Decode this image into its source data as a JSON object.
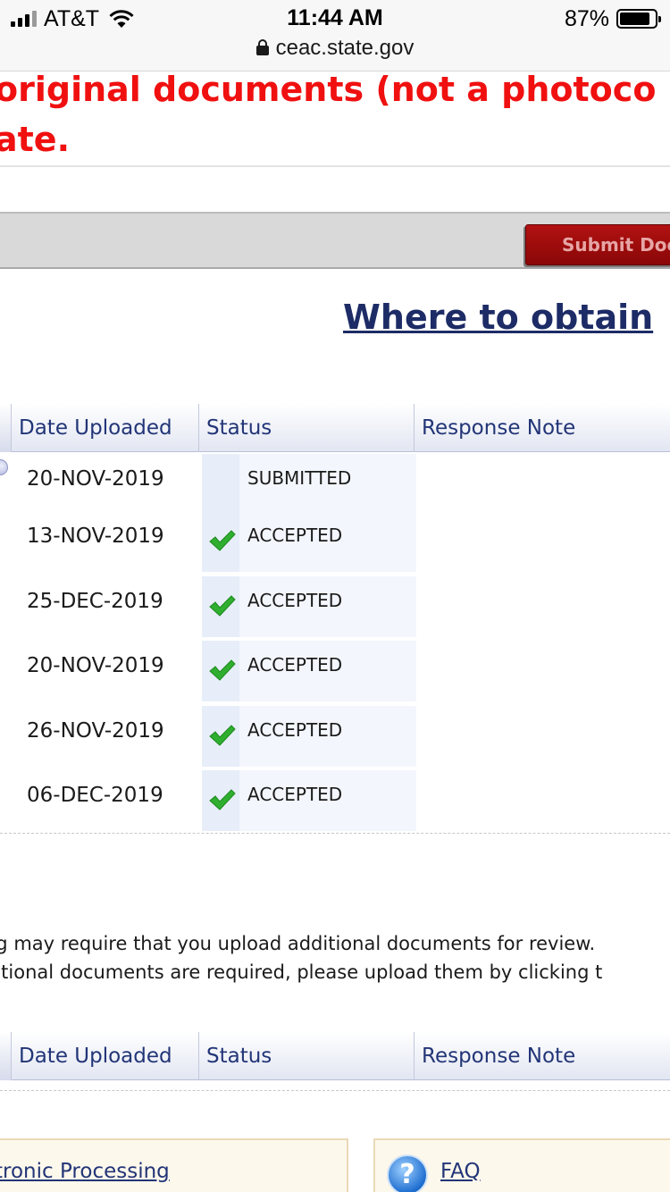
{
  "status_bar": {
    "carrier": "AT&T",
    "time": "11:44 AM",
    "battery_percent": "87%",
    "battery_level": 0.87,
    "url": "ceac.state.gov"
  },
  "warning": {
    "line1": "original documents (not a photoco",
    "line2": "ate."
  },
  "toolbar": {
    "submit_label": "Submit Doc"
  },
  "obtain_link": "Where to obtain",
  "table_headers": [
    "Date Uploaded",
    "Status",
    "Response Note"
  ],
  "documents": [
    {
      "date": "20-NOV-2019",
      "status": "SUBMITTED",
      "icon": "none"
    },
    {
      "date": "13-NOV-2019",
      "status": "ACCEPTED",
      "icon": "check-icon"
    },
    {
      "date": "25-DEC-2019",
      "status": "ACCEPTED",
      "icon": "check-icon"
    },
    {
      "date": "20-NOV-2019",
      "status": "ACCEPTED",
      "icon": "check-icon"
    },
    {
      "date": "26-NOV-2019",
      "status": "ACCEPTED",
      "icon": "check-icon"
    },
    {
      "date": "06-DEC-2019",
      "status": "ACCEPTED",
      "icon": "check-icon"
    }
  ],
  "additional_text": {
    "line1": "ng may require that you upload additional documents for review.",
    "line2": "ditional documents are required, please upload them by clicking t"
  },
  "additional_table_headers": [
    "Date Uploaded",
    "Status",
    "Response Note"
  ],
  "footer_links": {
    "processing": "tronic Processing",
    "faq": "FAQ",
    "faq_icon_glyph": "?"
  },
  "colors": {
    "warning_red": "#f01010",
    "link_navy": "#1d2c66",
    "submit_red": "#a10e0e",
    "check_green": "#2fae2f"
  }
}
